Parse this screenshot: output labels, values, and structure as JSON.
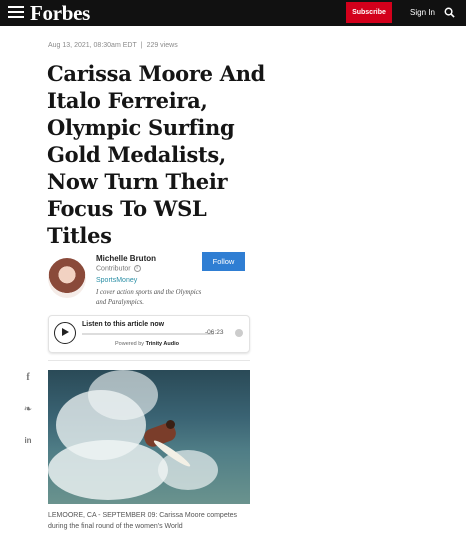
{
  "header": {
    "logo": "Forbes",
    "subscribe_label": "Subscribe",
    "signin_label": "Sign In"
  },
  "article": {
    "date": "Aug 13, 2021, 08:30am EDT",
    "separator": "|",
    "views": "229 views",
    "title": "Carissa Moore And Italo Ferreira, Olympic Surfing Gold Medalists, Now Turn Their Focus To WSL Titles"
  },
  "author": {
    "name": "Michelle Bruton",
    "role": "Contributor",
    "info_glyph": "i",
    "section": "SportsMoney",
    "bio": "I cover action sports and the Olympics and Paralympics.",
    "follow_label": "Follow"
  },
  "player": {
    "title": "Listen to this article now",
    "time": "-06:23",
    "powered_prefix": "Powered by",
    "powered_brand": "Trinity Audio"
  },
  "share": {
    "facebook_glyph": "f",
    "twitter_glyph": "❧",
    "linkedin_glyph": "in"
  },
  "caption": "LEMOORE, CA - SEPTEMBER 09: Carissa Moore competes during the final round of the women's World",
  "colors": {
    "topbar": "#111111",
    "subscribe": "#d3001b",
    "follow": "#2f7ed3",
    "section_link": "#2b8fa6"
  }
}
